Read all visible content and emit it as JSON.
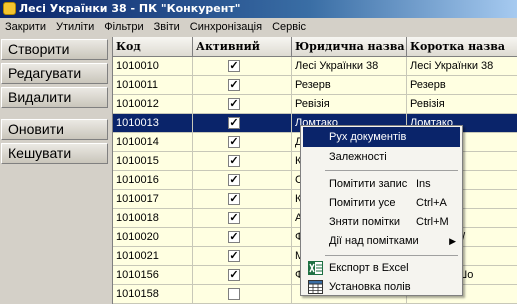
{
  "window": {
    "title": "Лесі Українки 38 - ПК \"Конкурент\""
  },
  "menu": [
    "Закрити",
    "Утиліти",
    "Фільтри",
    "Звіти",
    "Синхронізація",
    "Сервіс"
  ],
  "sidebar": {
    "buttons": [
      "Створити",
      "Редагувати",
      "Видалити",
      "Оновити",
      "Кешувати"
    ]
  },
  "table": {
    "columns": [
      "Код",
      "Активний",
      "Юридична назва",
      "Коротка назва"
    ],
    "rows": [
      {
        "code": "1010010",
        "active": true,
        "legal": "Лесі Українки 38",
        "short": "Лесі Українки 38"
      },
      {
        "code": "1010011",
        "active": true,
        "legal": "Резерв",
        "short": "Резерв"
      },
      {
        "code": "1010012",
        "active": true,
        "legal": "Ревізія",
        "short": "Ревізія"
      },
      {
        "code": "1010013",
        "active": true,
        "legal": "Ломтако",
        "short": "Ломтако",
        "selected": true
      },
      {
        "code": "1010014",
        "active": true,
        "legal": "Д",
        "short": ""
      },
      {
        "code": "1010015",
        "active": true,
        "legal": "К",
        "short": "о націнк"
      },
      {
        "code": "1010016",
        "active": true,
        "legal": "С",
        "short": "вовини"
      },
      {
        "code": "1010017",
        "active": true,
        "legal": "К",
        "short": "цех"
      },
      {
        "code": "1010018",
        "active": true,
        "legal": "А",
        "short": "ння"
      },
      {
        "code": "1010020",
        "active": true,
        "legal": "Ф",
        "short": "ниченк С. /"
      },
      {
        "code": "1010021",
        "active": true,
        "legal": "М",
        "short": ""
      },
      {
        "code": "1010156",
        "active": true,
        "legal": "Ф",
        "short": "стослав (Шо"
      },
      {
        "code": "1010158",
        "active": false,
        "legal": "",
        "short": ""
      }
    ]
  },
  "context_menu": {
    "items": [
      {
        "label": "Рух документів",
        "shortcut": "",
        "highlighted": true
      },
      {
        "label": "Залежності",
        "shortcut": ""
      },
      {
        "label": "Помітити запис",
        "shortcut": "Ins"
      },
      {
        "label": "Помітити усе",
        "shortcut": "Ctrl+A"
      },
      {
        "label": "Зняти помітки",
        "shortcut": "Ctrl+M"
      },
      {
        "label": "Дії над помітками",
        "shortcut": "",
        "submenu": true
      },
      {
        "label": "Експорт в Excel",
        "shortcut": "",
        "icon": "excel-icon"
      },
      {
        "label": "Установка полів",
        "shortcut": "",
        "icon": "table-settings-icon"
      }
    ]
  },
  "colors": {
    "selection": "#0a246a",
    "grid_bg": "#ffffe1",
    "title_start": "#0a246a",
    "title_end": "#a6caf0"
  }
}
